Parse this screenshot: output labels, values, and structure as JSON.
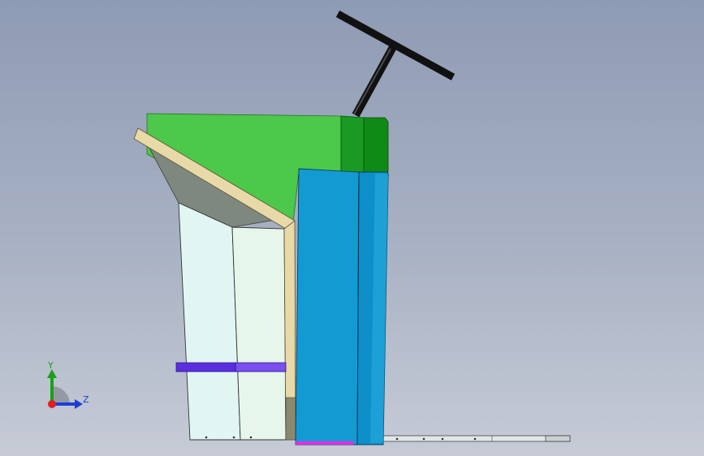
{
  "viewport": {
    "background_top": "#8e9bb4",
    "background_bottom": "#c6cbd6"
  },
  "model": {
    "colors": {
      "top_panel": "#4cc84a",
      "top_panel_dark": "#0f8a14",
      "blue_panel": "#129bd3",
      "blue_panel_dark": "#0b86bf",
      "chute": "#e7d9a8",
      "shade": "#7f887e",
      "front_panel": "#e4f5ef",
      "strap": "#6b3af0",
      "handle": "#111111",
      "base_rail": "#e2e6e6",
      "magenta_edge": "#e62be6"
    }
  },
  "triad": {
    "y_label": "Y",
    "z_label": "Z",
    "y_color": "#1aa01a",
    "z_color": "#1a3fd6",
    "x_color": "#e02020"
  }
}
